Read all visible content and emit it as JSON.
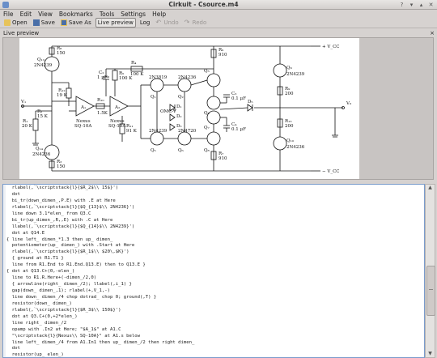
{
  "window": {
    "title": "Cirkuit - Csource.m4"
  },
  "menubar": {
    "items": [
      "File",
      "Edit",
      "View",
      "Bookmarks",
      "Tools",
      "Settings",
      "Help"
    ]
  },
  "toolbar": {
    "open": "Open",
    "save": "Save",
    "save_as": "Save As",
    "live_preview": "Live preview",
    "log": "Log",
    "undo": "Undo",
    "redo": "Redo"
  },
  "panel": {
    "title": "Live preview",
    "close": "×"
  },
  "circuit": {
    "labels": {
      "rq": "Q₁₃",
      "rq_pn": "2N4239",
      "r8": "R₈",
      "r8v": "150",
      "r12": "R₁₂",
      "r12v": "19 K",
      "r1": "R₁",
      "r1v": "20 K",
      "r3": "R₃",
      "r3v": "150",
      "q14": "Q₁₄",
      "q14pn": "2N4236",
      "c2": "C₂",
      "c2v": "1 µF",
      "r4": "R₄",
      "r4v": "100 K",
      "r5": "R₅",
      "r5v": "100 K",
      "a1": "A₁",
      "a1n": "Nexus",
      "a1pn": "SQ-10A",
      "a2": "A₂",
      "a2n": "Nexus",
      "a2pn": "SQ-10A",
      "r10": "R₁₀",
      "r10v": "1.5K",
      "r11": "R₁₁",
      "r11v": "91 K",
      "r2": "R₂",
      "r2v": "15 K",
      "r6": "R₆",
      "r6v": "910",
      "r7": "R₇",
      "r7v": "910",
      "q1": "Q₁",
      "q2": "Q₂",
      "q3": "Q₃",
      "q4": "Q₄",
      "q5": "Q₅",
      "q6": "Q₆",
      "q7": "Q₇",
      "q8": "Q₈",
      "q9": "Q₉",
      "q10": "Q₁₀",
      "d1": "D₁",
      "d2": "D₂",
      "d3": "D₃",
      "d4": "D₄",
      "d5": "D₅",
      "c3": "C₃",
      "c4": "C₄",
      "c3v": "0.1 µF",
      "c4v": "0.1 µF",
      "r9": "R₉",
      "r9v": "200",
      "r13": "R₁₃",
      "r13v": "200",
      "vcc": "+ V_CC",
      "vcc_n": "− V_CC",
      "v1": "V₁",
      "vo": "V₀",
      "omc": "OMC-V",
      "pn_2n4236": "2N4236",
      "pn_2n3819": "2N3819",
      "pn_2n4239": "2N4239",
      "pn_2n4720": "2N4720"
    }
  },
  "code_lines": [
    "  rlabel(,`\\scriptstack{l}{$R_2$\\\\ 15$}')",
    "  dot",
    "  bi_tr(down_dimen_,P.E) with .E at Here",
    "  rlabel(,`\\scriptstack{l}{$Q_{13}$\\\\ 2N4236}')",
    "  line down 3.1*elen_ from Q3.C",
    "  bi_tr(up_dimen_,R,,E) with .C at Here",
    "  llabel(,`\\scriptstack{l}{$Q_{14}$\\\\ 2N4239}')",
    "  dot at Q14.E",
    "{ line left_ dimen_*1.3 then up_ dimen_",
    "  potentiometer(up_ dimen_) with .Start at Here",
    "  rlabel(,`\\scriptstack{l}{$R_1$\\\\ $20\\,$K}')",
    "  { ground at R1.T1 }",
    "  line from R1.End to R1.End.Q13.E) then to Q13.E }",
    "{ dot at Q13.C+(0,-elen_)",
    "  line to R1.R.Here+(-dimen_/2,0)",
    "  { arrowline(right_ dimen_/2); llabel(,i_1) }",
    "  gap(down_ dimen_,1); rlabel(+,V_1,-)",
    "  line down_ dimen_/4 chop dotrad_ chop 0; ground(,T) }",
    "  resistor(down_ dimen_)",
    "  rlabel(,`\\scriptstack{l}{$R_3$\\\\ 150$}')",
    "  dot at Q3.C+(0,+2*elen_)",
    "  line right_ dimen_/2",
    "  opamp with .In2 at Here; \"$A_1$\" at A1.C",
    "  \"\\scriptstack{l}{Nexus\\\\ SQ-10A}\" at A1.s below",
    "  line left_ dimen_/4 from A1.In1 then up_ dimen_/2 then right dimen_",
    "  dot",
    "  resistor(up_ elen_)",
    "  rlabel(,`\\scriptstack{l}{$R_{14}$\\\\ $19\\,$K}')"
  ]
}
